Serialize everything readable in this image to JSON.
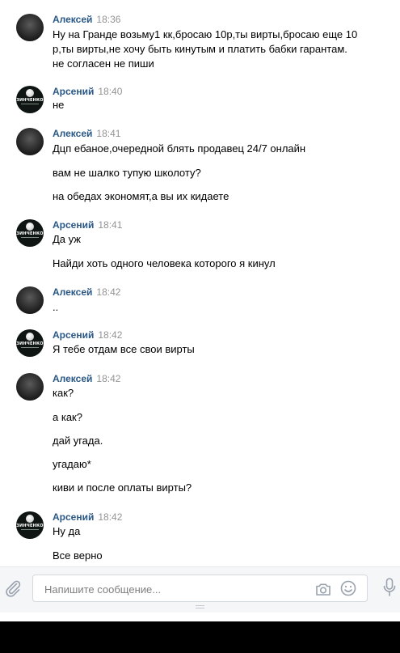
{
  "conversation": {
    "messages": [
      {
        "author": "Алексей",
        "time": "18:36",
        "avatar": "alexey-avatar",
        "lines": [
          "Ну на Гранде возьму1 кк,бросаю 10р,ты вирты,бросаю еще 10",
          "р,ты вирты,не хочу быть кинутым и платить бабки гарантам.",
          "не согласен не пиши"
        ]
      },
      {
        "author": "Арсений",
        "time": "18:40",
        "avatar": "arseniy-avatar",
        "lines": [
          "не"
        ]
      },
      {
        "author": "Алексей",
        "time": "18:41",
        "avatar": "alexey-avatar",
        "lines": [
          "Дцп ебаное,очередной блять продавец 24/7 онлайн",
          "вам не шалко тупую школоту?",
          "на обедах экономят,а вы их кидаете"
        ]
      },
      {
        "author": "Арсений",
        "time": "18:41",
        "avatar": "arseniy-avatar",
        "lines": [
          "Да уж",
          "Найди хоть одного человека которого я кинул"
        ]
      },
      {
        "author": "Алексей",
        "time": "18:42",
        "avatar": "alexey-avatar",
        "lines": [
          ".."
        ]
      },
      {
        "author": "Арсений",
        "time": "18:42",
        "avatar": "arseniy-avatar",
        "lines": [
          "Я тебе отдам все свои вирты"
        ]
      },
      {
        "author": "Алексей",
        "time": "18:42",
        "avatar": "alexey-avatar",
        "lines": [
          "как?",
          "а как?",
          "дай угада.",
          "угадаю*",
          "киви и после оплаты вирты?"
        ]
      },
      {
        "author": "Арсений",
        "time": "18:42",
        "avatar": "arseniy-avatar",
        "lines": [
          "Ну да",
          "Все верно"
        ]
      }
    ]
  },
  "avatar_brand": "ЗИНЧЕНКО",
  "composer": {
    "placeholder": "Напишите сообщение...",
    "icons": [
      "paperclip-icon",
      "camera-icon",
      "smile-icon",
      "microphone-icon"
    ]
  },
  "colors": {
    "author": "#2a5885",
    "time": "#939393",
    "composer_bg": "#f5f6f8",
    "bottom_bar": "#000000"
  }
}
